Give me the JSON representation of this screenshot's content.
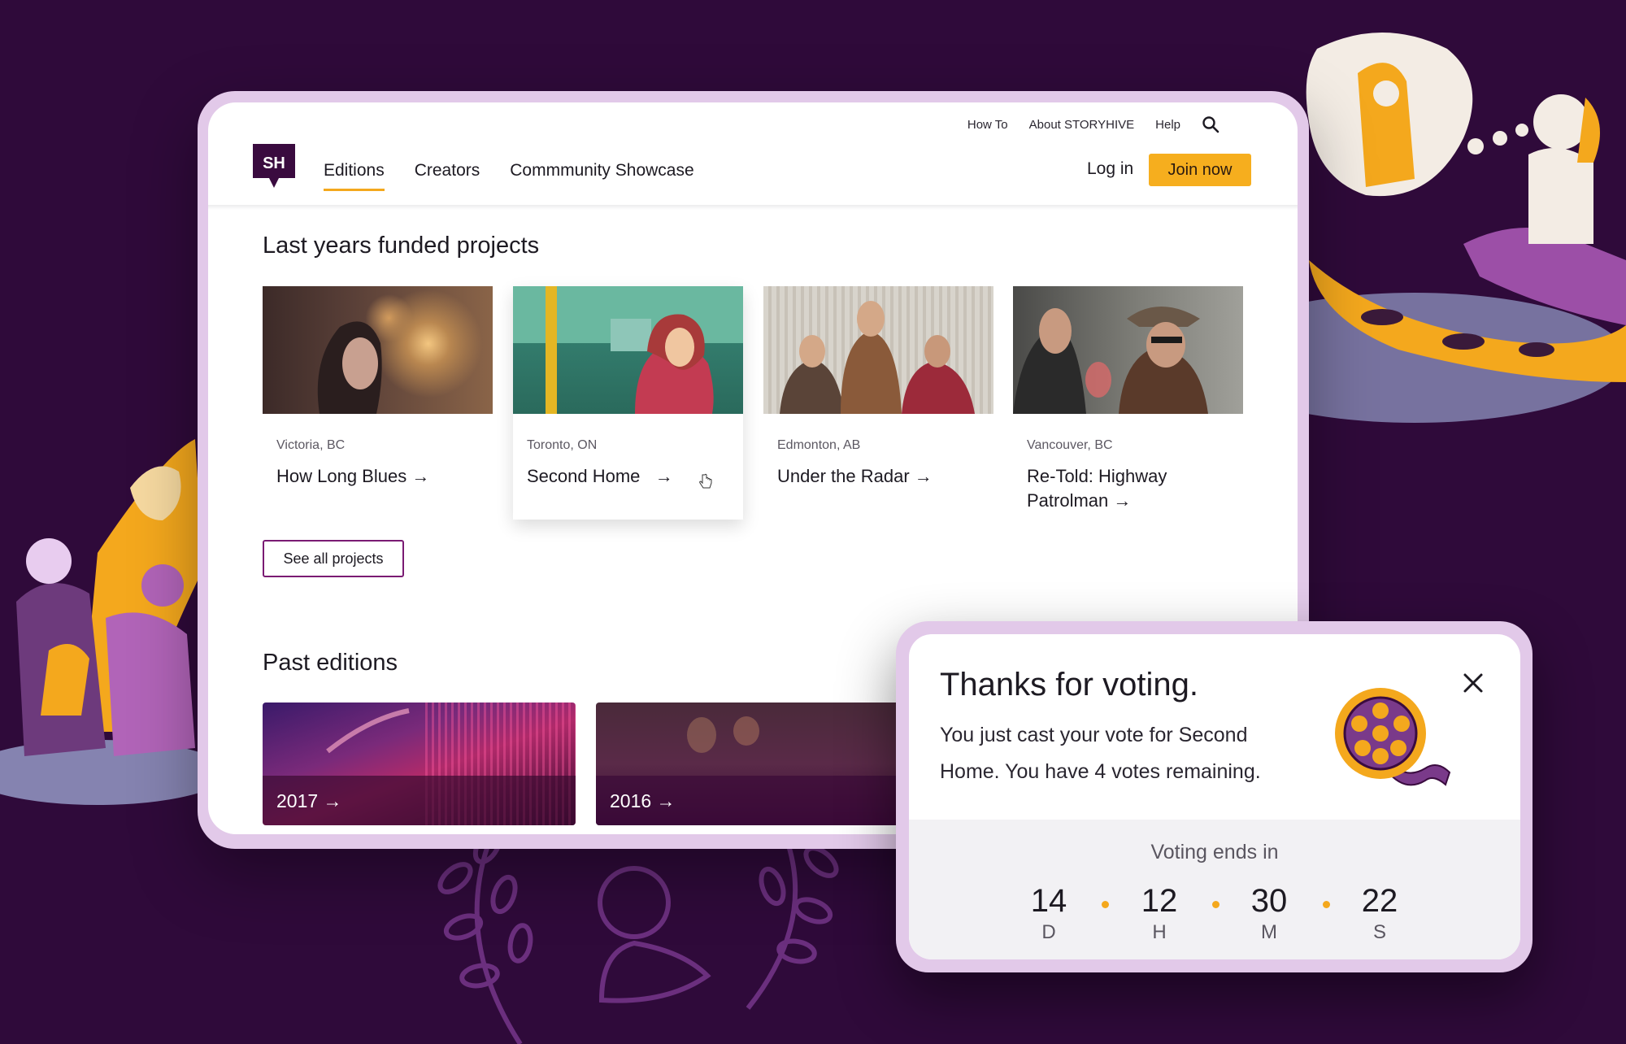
{
  "header": {
    "top_links": [
      "How To",
      "About STORYHIVE",
      "Help"
    ],
    "logo_text": "SH",
    "nav": [
      {
        "label": "Editions",
        "active": true
      },
      {
        "label": "Creators",
        "active": false
      },
      {
        "label": "Commmunity Showcase",
        "active": false
      }
    ],
    "login_label": "Log in",
    "join_label": "Join now"
  },
  "funded": {
    "title": "Last years funded projects",
    "projects": [
      {
        "location": "Victoria, BC",
        "title": "How Long Blues →"
      },
      {
        "location": "Toronto, ON",
        "title": "Second Home   →"
      },
      {
        "location": "Edmonton, AB",
        "title": "Under the Radar →"
      },
      {
        "location": "Vancouver, BC",
        "title": "Re-Told: Highway Patrolman →"
      }
    ],
    "see_all_label": "See all projects"
  },
  "past_editions": {
    "title": "Past editions",
    "items": [
      "2017 →",
      "2016 →"
    ]
  },
  "modal": {
    "title": "Thanks for voting.",
    "body": "You just cast your vote for Second Home. You have 4 votes remaining.",
    "countdown_title": "Voting ends in",
    "countdown": [
      {
        "value": "14",
        "unit": "D"
      },
      {
        "value": "12",
        "unit": "H"
      },
      {
        "value": "30",
        "unit": "M"
      },
      {
        "value": "22",
        "unit": "S"
      }
    ]
  },
  "colors": {
    "background": "#2f0a3a",
    "accent": "#f6ae1e",
    "brand": "#3a0b3f",
    "frame": "#e2c9e9",
    "outline": "#7a1b73"
  }
}
